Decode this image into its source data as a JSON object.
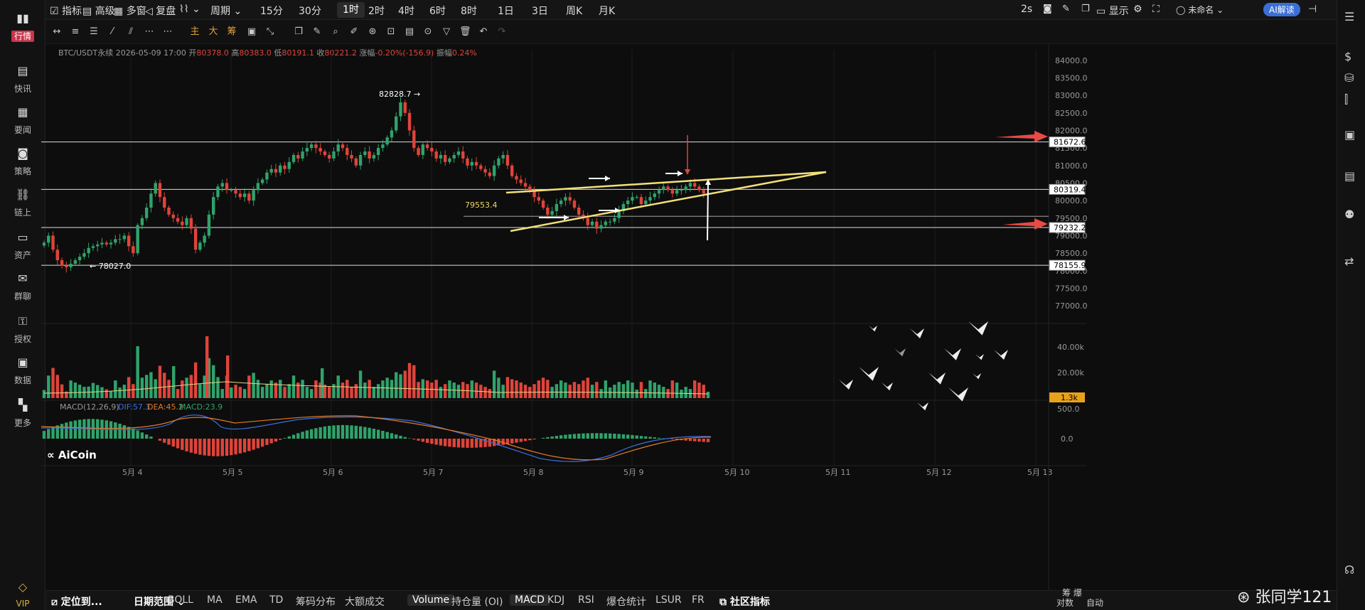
{
  "topbar": {
    "indicator": "指标",
    "advanced": "高级",
    "multiwin": "多窗",
    "replay": "复盘",
    "period": "周期",
    "timeframes": [
      "15分",
      "30分",
      "1时",
      "2时",
      "4时",
      "6时",
      "8时",
      "1日",
      "3日",
      "周K",
      "月K"
    ],
    "active_tf": "1时",
    "refresh": "2s",
    "display": "显示",
    "layout_name": "未命名",
    "ai_button": "AI解读"
  },
  "sidebar": [
    {
      "label": "行情",
      "icon": "chart-icon",
      "active": true
    },
    {
      "label": "快讯",
      "icon": "news-icon"
    },
    {
      "label": "要闻",
      "icon": "document-icon"
    },
    {
      "label": "策略",
      "icon": "robot-icon"
    },
    {
      "label": "链上",
      "icon": "chain-icon"
    },
    {
      "label": "资产",
      "icon": "wallet-icon"
    },
    {
      "label": "群聊",
      "icon": "chat-icon"
    },
    {
      "label": "授权",
      "icon": "key-icon"
    },
    {
      "label": "数据",
      "icon": "monitor-icon"
    },
    {
      "label": "更多",
      "icon": "grid-icon"
    },
    {
      "label": "VIP",
      "icon": "diamond-icon"
    }
  ],
  "ohlc": {
    "symbol": "BTC/USDT永续",
    "datetime": "2026-05-09 17:00",
    "open_label": "开",
    "open": "80378.0",
    "high_label": "高",
    "high": "80383.0",
    "low_label": "低",
    "low": "80191.1",
    "close_label": "收",
    "close": "80221.2",
    "change_label": "涨幅",
    "change": "-0.20%(-156.9)",
    "amp_label": "振幅",
    "amp": "0.24%"
  },
  "chart_data": {
    "type": "candlestick",
    "symbol": "BTC/USDT",
    "y_ticks": [
      "84000.0",
      "83500.0",
      "83000.0",
      "82500.0",
      "82000.0",
      "81500.0",
      "81000.0",
      "80500.0",
      "80000.0",
      "79500.0",
      "79000.0",
      "78500.0",
      "78000.0",
      "77500.0",
      "77000.0"
    ],
    "ylim": [
      76800,
      84300
    ],
    "x_ticks": [
      "5月 4",
      "5月 5",
      "5月 6",
      "5月 7",
      "5月 8",
      "5月 9",
      "5月 10",
      "5月 11",
      "5月 12",
      "5月 13"
    ],
    "close_path": [
      78800,
      79000,
      78600,
      78300,
      78150,
      78100,
      78200,
      78300,
      78400,
      78500,
      78650,
      78700,
      78750,
      78800,
      78750,
      78800,
      78900,
      78900,
      79000,
      78700,
      78500,
      79300,
      79500,
      79800,
      80200,
      80500,
      80100,
      79800,
      79600,
      79500,
      79400,
      79300,
      79500,
      79200,
      78600,
      78800,
      79000,
      79600,
      80100,
      80400,
      80500,
      80300,
      80300,
      80200,
      80100,
      80200,
      80000,
      80300,
      80500,
      80600,
      80800,
      80900,
      80800,
      81000,
      80900,
      81100,
      81300,
      81200,
      81400,
      81500,
      81600,
      81500,
      81400,
      81300,
      81200,
      81400,
      81600,
      81500,
      81300,
      81200,
      81000,
      81300,
      81400,
      81200,
      81300,
      81500,
      81600,
      81800,
      82000,
      82400,
      82800,
      82500,
      82000,
      81500,
      81300,
      81600,
      81500,
      81400,
      81200,
      81300,
      81100,
      81200,
      81300,
      81400,
      81200,
      81000,
      81100,
      81000,
      80900,
      80800,
      80700,
      81000,
      81200,
      81300,
      81000,
      80700,
      80600,
      80500,
      80400,
      80300,
      80100,
      80000,
      79800,
      79600,
      79700,
      79900,
      80000,
      80100,
      80000,
      79800,
      79600,
      79500,
      79300,
      79400,
      79200,
      79300,
      79400,
      79400,
      79500,
      79700,
      79900,
      80000,
      80100,
      80100,
      79900,
      80000,
      80100,
      80200,
      80300,
      80400,
      80300,
      80200,
      80300,
      80300,
      80400,
      80500,
      80400,
      80300,
      80200,
      80200
    ],
    "annotations": {
      "high_label": "82828.7",
      "low_label": "← 78027.0",
      "mid_label": "79553.4",
      "levels": [
        "81672.6",
        "80319.4",
        "79232.2",
        "78155.9"
      ]
    },
    "volume_ticks": [
      "40.00k",
      "20.00k"
    ],
    "volume_last": "1.3k",
    "macd": {
      "label": "MACD(12,26,9)",
      "dif": "DIF:57.3",
      "dea": "DEA:45.2",
      "macd": "MACD:23.9",
      "ticks": [
        "500.0",
        "0.0"
      ]
    }
  },
  "logo": "AiCoin",
  "bottom": {
    "locate": "定位到...",
    "date_range": "日期范围",
    "items": [
      "BOLL",
      "MA",
      "EMA",
      "TD",
      "筹码分布",
      "大额成交",
      "Volume",
      "持仓量 (OI)",
      "MACD",
      "KDJ",
      "RSI",
      "爆仓统计",
      "LSUR",
      "FR",
      "社区指标"
    ],
    "active": [
      "Volume",
      "MACD"
    ],
    "right_labels": [
      "筹 爆",
      "对数",
      "自动"
    ]
  },
  "watermark": "张同学121",
  "colors": {
    "up": "#2fa36b",
    "down": "#e0443a",
    "accent": "#f0d860",
    "bg": "#0d0d0d"
  }
}
